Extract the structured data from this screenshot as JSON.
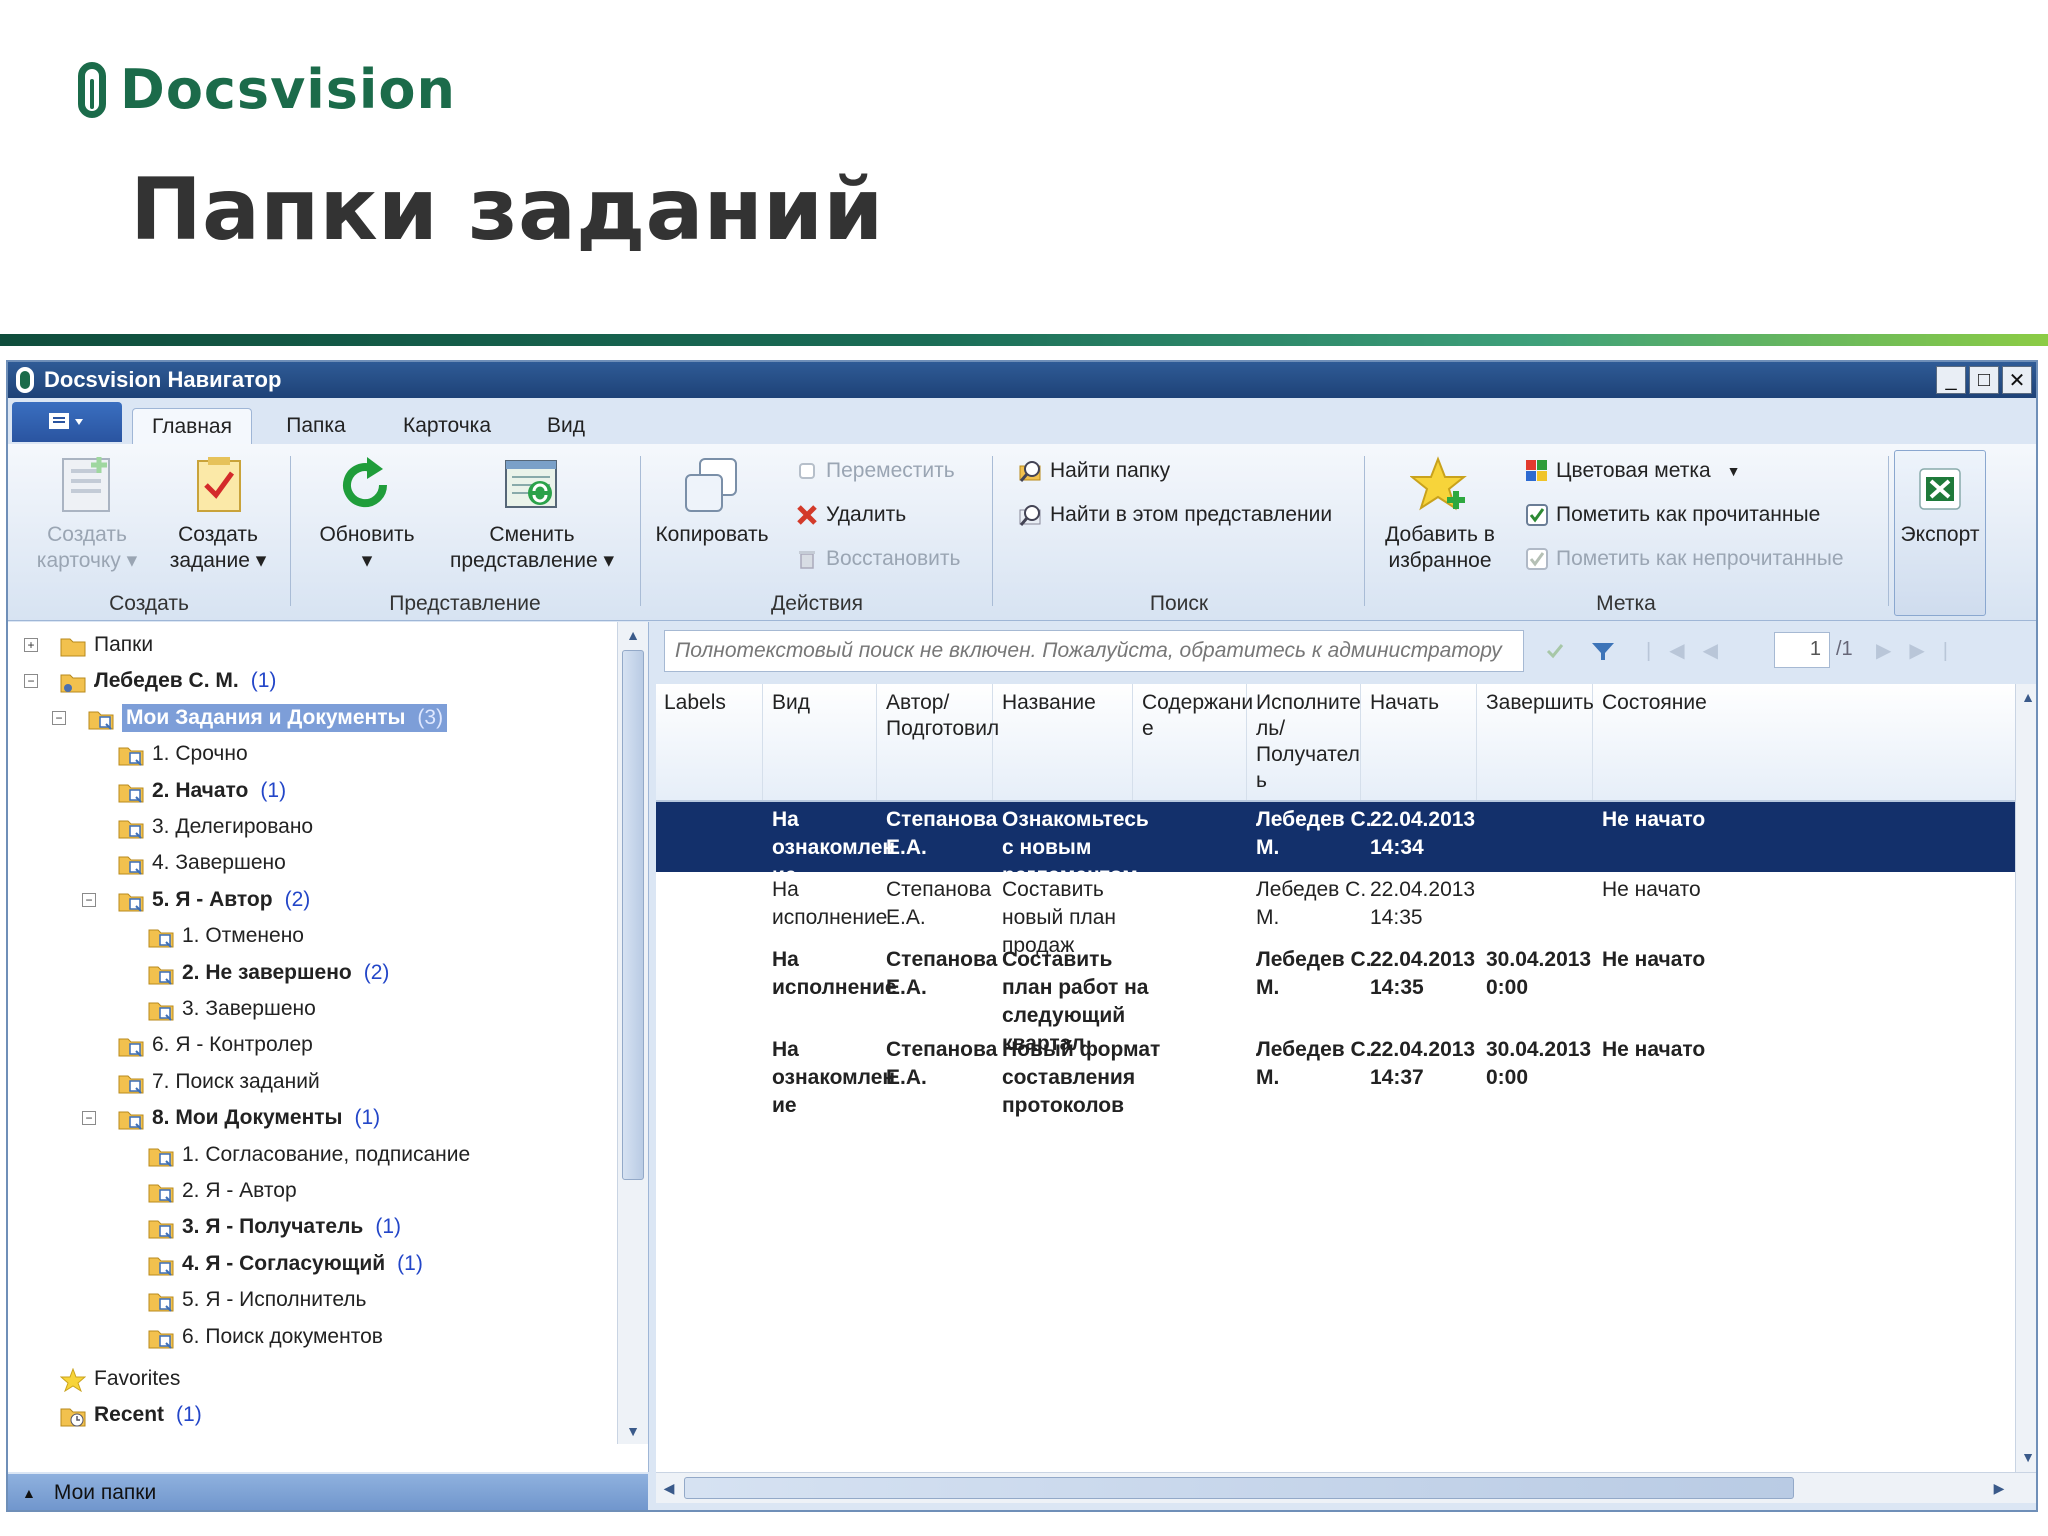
{
  "slide": {
    "logo_text": "Docsvision",
    "title": "Папки заданий"
  },
  "window": {
    "title": "Docsvision Навигатор",
    "controls": [
      "_",
      "□",
      "✕"
    ]
  },
  "tabs": [
    "Главная",
    "Папка",
    "Карточка",
    "Вид"
  ],
  "ribbon": {
    "create": {
      "group_label": "Создать",
      "create_card": [
        "Создать",
        "карточку ▾"
      ],
      "create_task": [
        "Создать",
        "задание ▾"
      ]
    },
    "view": {
      "group_label": "Представление",
      "refresh": [
        "Обновить",
        "▾"
      ],
      "change_view": [
        "Сменить",
        "представление ▾"
      ]
    },
    "actions": {
      "group_label": "Действия",
      "copy": "Копировать",
      "move": "Переместить",
      "delete": "Удалить",
      "restore": "Восстановить"
    },
    "search": {
      "group_label": "Поиск",
      "find_folder": "Найти папку",
      "find_in_view": "Найти в этом представлении"
    },
    "mark": {
      "group_label": "Метка",
      "add_favorites": [
        "Добавить в",
        "избранное"
      ],
      "color_mark": "Цветовая метка",
      "mark_read": "Пометить как прочитанные",
      "mark_unread": "Пометить как непрочитанные"
    },
    "export": "Экспорт"
  },
  "tree": [
    {
      "label": "Папки",
      "count": "",
      "bold": false
    },
    {
      "label": "Лебедев С. М.",
      "count": "(1)",
      "bold": true
    },
    {
      "label": "Мои Задания и Документы",
      "count": "(3)",
      "bold": true
    },
    {
      "label": "1. Срочно",
      "count": "",
      "bold": false
    },
    {
      "label": "2. Начато",
      "count": "(1)",
      "bold": true
    },
    {
      "label": "3. Делегировано",
      "count": "",
      "bold": false
    },
    {
      "label": "4. Завершено",
      "count": "",
      "bold": false
    },
    {
      "label": "5. Я - Автор",
      "count": "(2)",
      "bold": true
    },
    {
      "label": "1. Отменено",
      "count": "",
      "bold": false
    },
    {
      "label": "2. Не завершено",
      "count": "(2)",
      "bold": true
    },
    {
      "label": "3. Завершено",
      "count": "",
      "bold": false
    },
    {
      "label": "6. Я - Контролер",
      "count": "",
      "bold": false
    },
    {
      "label": "7. Поиск заданий",
      "count": "",
      "bold": false
    },
    {
      "label": "8. Мои Документы",
      "count": "(1)",
      "bold": true
    },
    {
      "label": "1. Согласование, подписание",
      "count": "",
      "bold": false
    },
    {
      "label": "2. Я - Автор",
      "count": "",
      "bold": false
    },
    {
      "label": "3. Я - Получатель",
      "count": "(1)",
      "bold": true
    },
    {
      "label": "4. Я - Согласующий",
      "count": "(1)",
      "bold": true
    },
    {
      "label": "5. Я - Исполнитель",
      "count": "",
      "bold": false
    },
    {
      "label": "6. Поиск документов",
      "count": "",
      "bold": false
    },
    {
      "label": "Favorites",
      "count": "",
      "bold": false
    },
    {
      "label": "Recent",
      "count": "(1)",
      "bold": true
    }
  ],
  "bottom_bar": "Мои папки",
  "search": {
    "placeholder": "Полнотекстовый поиск не включен. Пожалуйста, обратитесь к администратору",
    "page": "1",
    "total": "/1"
  },
  "grid": {
    "columns": [
      [
        "Labels"
      ],
      [
        "Вид"
      ],
      [
        "Автор/",
        "Подготовил"
      ],
      [
        "Название"
      ],
      [
        "Содержани",
        "е"
      ],
      [
        "Исполните",
        "ль/",
        "Получател",
        "ь"
      ],
      [
        "Начать"
      ],
      [
        "Завершить"
      ],
      [
        "Состояние"
      ]
    ],
    "rows": [
      {
        "labels": "",
        "kind": [
          "На",
          "ознакомлен",
          "ие"
        ],
        "author": [
          "Степанова",
          "Е.А."
        ],
        "name": [
          "Ознакомьтесь",
          "с новым",
          "регламентом"
        ],
        "content": "",
        "executor": [
          "Лебедев С.",
          "М."
        ],
        "start": [
          "22.04.2013",
          "14:34"
        ],
        "end": [
          "",
          ""
        ],
        "state": "Не начато",
        "bold": true,
        "selected": true
      },
      {
        "labels": "",
        "kind": [
          "На",
          "исполнение"
        ],
        "author": [
          "Степанова",
          "Е.А."
        ],
        "name": [
          "Составить",
          "новый план",
          "продаж"
        ],
        "content": "",
        "executor": [
          "Лебедев С.",
          "М."
        ],
        "start": [
          "22.04.2013",
          "14:35"
        ],
        "end": [
          "",
          ""
        ],
        "state": "Не начато",
        "bold": false,
        "selected": false
      },
      {
        "labels": "",
        "kind": [
          "На",
          "исполнение"
        ],
        "author": [
          "Степанова",
          "Е.А."
        ],
        "name": [
          "Составить",
          "план работ на",
          "следующий",
          "квартал"
        ],
        "content": "",
        "executor": [
          "Лебедев С.",
          "М."
        ],
        "start": [
          "22.04.2013",
          "14:35"
        ],
        "end": [
          "30.04.2013",
          "0:00"
        ],
        "state": "Не начато",
        "bold": true,
        "selected": false
      },
      {
        "labels": "",
        "kind": [
          "На",
          "ознакомлен",
          "ие"
        ],
        "author": [
          "Степанова",
          "Е.А."
        ],
        "name": [
          "Новый формат",
          "составления",
          "протоколов"
        ],
        "content": "",
        "executor": [
          "Лебедев С.",
          "М."
        ],
        "start": [
          "22.04.2013",
          "14:37"
        ],
        "end": [
          "30.04.2013",
          "0:00"
        ],
        "state": "Не начато",
        "bold": true,
        "selected": false
      }
    ]
  },
  "colors": {
    "brand": "#1b6b4a",
    "selected_row": "#13306b",
    "count": "#2346c8"
  }
}
